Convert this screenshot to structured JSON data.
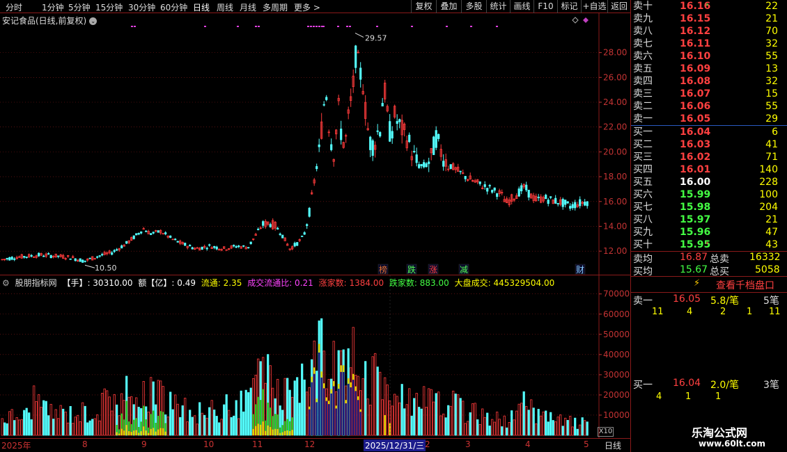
{
  "top_toolbar": {
    "periods": [
      "分时",
      "1分钟",
      "5分钟",
      "15分钟",
      "30分钟",
      "60分钟",
      "日线",
      "周线",
      "月线",
      "多周期",
      "更多 >"
    ],
    "active_period": "日线",
    "buttons": [
      "复权",
      "叠加",
      "多股",
      "统计",
      "画线",
      "F10",
      "标记",
      "+自选",
      "返回"
    ]
  },
  "stock": {
    "title": "安记食品(日线,前复权)"
  },
  "main_chart": {
    "y_ticks": [
      "28.00",
      "26.00",
      "24.00",
      "22.00",
      "20.00",
      "18.00",
      "16.00",
      "14.00",
      "12.00"
    ],
    "y_tick_values": [
      28,
      26,
      24,
      22,
      20,
      18,
      16,
      14,
      12
    ],
    "y_range": [
      11,
      30.5
    ],
    "high_label": "29.57",
    "low_label": "10.50",
    "event_marks": [
      {
        "text": "榜",
        "color": "#e07030"
      },
      {
        "text": "跌",
        "color": "#55ff55"
      },
      {
        "text": "涨",
        "color": "#ff4040"
      },
      {
        "text": "减",
        "color": "#55ff55"
      },
      {
        "text": "财",
        "color": "#88ccff"
      }
    ]
  },
  "indicator": {
    "name": "股朋指标网",
    "shou_label": "【手】: 30310.00",
    "e_label": "额【亿】: 0.49",
    "liutong": "流通: 2.35",
    "cjltb": "成交流通比: 0.21",
    "zhangjia": "涨家数: 1384.00",
    "diejia": "跌家数: 883.00",
    "dapan": "大盘成交: 445329504.00",
    "colors": {
      "name": "#dddddd",
      "shou": "#ffffff",
      "liutong": "#ffff00",
      "cjltb": "#ff44ff",
      "zhangjia": "#ff4040",
      "diejia": "#44ff44",
      "dapan": "#ffff00"
    }
  },
  "volume_chart": {
    "y_ticks": [
      "70000",
      "60000",
      "50000",
      "40000",
      "30000",
      "20000",
      "10000"
    ],
    "y_tick_values": [
      70000,
      60000,
      50000,
      40000,
      30000,
      20000,
      10000
    ],
    "y_max": 73000,
    "multiplier": "X10"
  },
  "x_axis": {
    "labels": [
      "2025年",
      "8",
      "9",
      "10",
      "11",
      "12",
      "1",
      "2",
      "3",
      "4",
      "5"
    ],
    "selected_date": "2025/12/31/三",
    "period_label": "日线"
  },
  "order_book": {
    "asks": [
      {
        "label": "卖十",
        "price": "16.16",
        "qty": "22",
        "mark": "*"
      },
      {
        "label": "卖九",
        "price": "16.15",
        "qty": "21"
      },
      {
        "label": "卖八",
        "price": "16.12",
        "qty": "70"
      },
      {
        "label": "卖七",
        "price": "16.11",
        "qty": "32"
      },
      {
        "label": "卖六",
        "price": "16.10",
        "qty": "55"
      },
      {
        "label": "卖五",
        "price": "16.09",
        "qty": "13"
      },
      {
        "label": "卖四",
        "price": "16.08",
        "qty": "32"
      },
      {
        "label": "卖三",
        "price": "16.07",
        "qty": "15"
      },
      {
        "label": "卖二",
        "price": "16.06",
        "qty": "55"
      },
      {
        "label": "卖一",
        "price": "16.05",
        "qty": "29"
      }
    ],
    "bids": [
      {
        "label": "买一",
        "price": "16.04",
        "qty": "6",
        "color": "#ff4040"
      },
      {
        "label": "买二",
        "price": "16.03",
        "qty": "41",
        "color": "#ff4040"
      },
      {
        "label": "买三",
        "price": "16.02",
        "qty": "71",
        "color": "#ff4040"
      },
      {
        "label": "买四",
        "price": "16.01",
        "qty": "140",
        "color": "#ff4040"
      },
      {
        "label": "买五",
        "price": "16.00",
        "qty": "228",
        "color": "#ffffff"
      },
      {
        "label": "买六",
        "price": "15.99",
        "qty": "100",
        "color": "#44ff44"
      },
      {
        "label": "买七",
        "price": "15.98",
        "qty": "204",
        "color": "#44ff44"
      },
      {
        "label": "买八",
        "price": "15.97",
        "qty": "21",
        "color": "#44ff44"
      },
      {
        "label": "买九",
        "price": "15.96",
        "qty": "47",
        "color": "#44ff44"
      },
      {
        "label": "买十",
        "price": "15.95",
        "qty": "43",
        "color": "#44ff44",
        "mark": "*"
      }
    ],
    "avg_sell_label": "卖均",
    "avg_sell_price": "16.87",
    "total_sell_label": "总卖",
    "total_sell": "16332",
    "avg_buy_label": "买均",
    "avg_buy_price": "15.67",
    "total_buy_label": "总买",
    "total_buy": "5058",
    "thousand_button": "查看千档盘口",
    "sell1_label": "卖一",
    "sell1_price": "16.05",
    "sell1_avg": "5.8/笔",
    "sell1_count": "5笔",
    "sell1_orders": [
      "11",
      "4",
      "2",
      "1",
      "11"
    ],
    "buy1_label": "买一",
    "buy1_price": "16.04",
    "buy1_avg": "2.0/笔",
    "buy1_count": "3笔",
    "buy1_orders": [
      "4",
      "1",
      "1"
    ]
  },
  "watermark": {
    "title": "乐淘公式网",
    "url": "www.60lt.com"
  },
  "colors": {
    "up": "#ff3b3b",
    "down": "#54ffff",
    "grid": "#8b1a1a",
    "axis_text": "#c33333"
  }
}
